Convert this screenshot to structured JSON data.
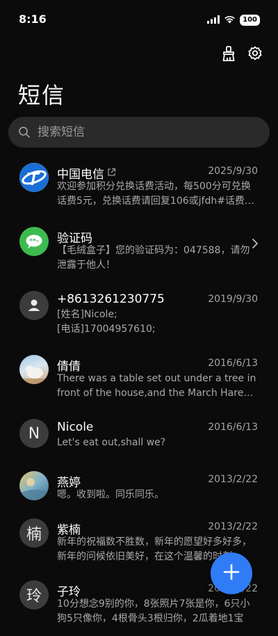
{
  "status": {
    "time": "8:16",
    "battery": "100"
  },
  "header": {
    "title": "短信"
  },
  "search": {
    "placeholder": "搜索短信"
  },
  "conversations": [
    {
      "name": "中国电信",
      "date": "2025/9/30",
      "preview": "欢迎参加积分兑换话费活动，每500分可兑换话费5元，兑换话费请回复106或jfdh#话费…",
      "avatar": "china-telecom-logo-icon"
    },
    {
      "name": "验证码",
      "date": "",
      "preview": "【毛绒盒子】您的验证码为：047588，请勿泄露于他人！",
      "avatar": "message-bubble-icon"
    },
    {
      "name": "+8613261230775",
      "date": "2019/9/30",
      "preview": "[姓名]Nicole;\n[电话]17004957610;",
      "avatar": "person-icon"
    },
    {
      "name": "倩倩",
      "date": "2016/6/13",
      "preview": "There was a table set out under a tree in front of the house,and the March Hare an…",
      "avatar": "photo-avatar-icon"
    },
    {
      "name": "Nicole",
      "date": "2016/6/13",
      "preview": "Let's eat out,shall we?",
      "avatar_letter": "N"
    },
    {
      "name": "燕婷",
      "date": "2013/2/22",
      "preview": "嗯。收到啦。同乐同乐。",
      "avatar": "photo-avatar-icon"
    },
    {
      "name": "紫楠",
      "date": "2013/2/22",
      "preview": "新年的祝福数不胜数，新年的愿望好多好多，新年的问候依旧美好，在这个温馨的时刻…",
      "avatar_letter": "楠"
    },
    {
      "name": "子玲",
      "date": "2013/2/22",
      "preview": "10分想念9别的你，8张照片7张是你，6只小狗5只像你，4根骨头3根归你，2瓜着地1宝",
      "avatar_letter": "玲"
    }
  ],
  "colors": {
    "accent": "#2f7cf6",
    "background": "#0b0b0b",
    "search_bg": "#2a2a2a",
    "telecom_blue": "#1a6fd6",
    "sms_green": "#3dbb4f"
  }
}
